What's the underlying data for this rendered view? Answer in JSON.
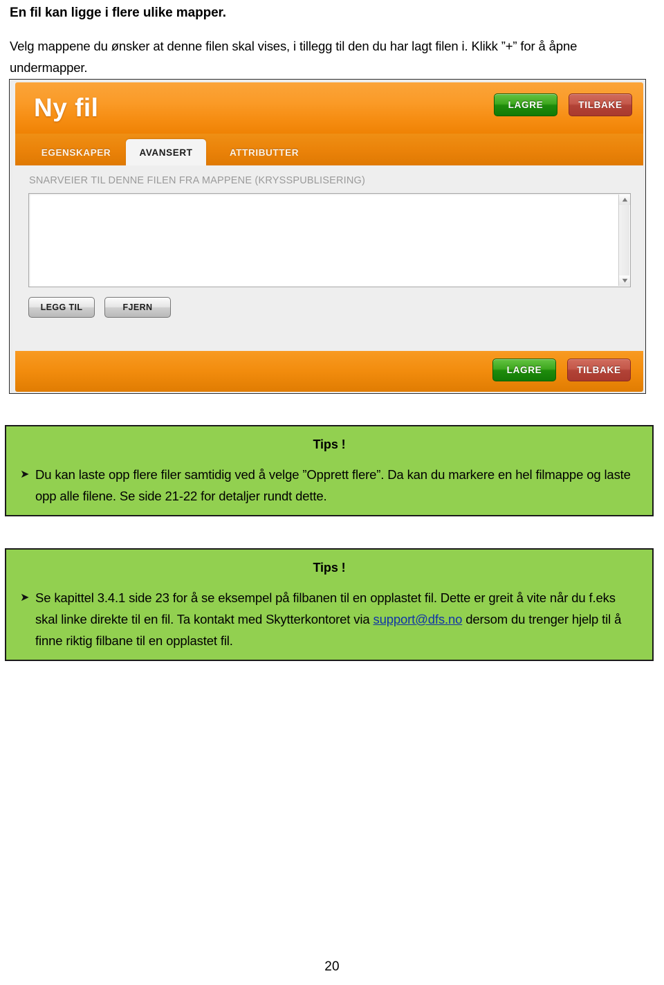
{
  "document": {
    "heading": "En fil kan ligge i flere ulike mapper.",
    "paragraph": "Velg mappene du ønsker at denne filen skal vises, i tillegg til den du har lagt filen i. Klikk ”+” for å åpne undermapper.",
    "page_number": "20"
  },
  "screenshot": {
    "app_title": "Ny fil",
    "header_buttons": {
      "save_label": "LAGRE",
      "back_label": "TILBAKE"
    },
    "tabs": [
      {
        "label": "EGENSKAPER",
        "active": false
      },
      {
        "label": "AVANSERT",
        "active": true
      },
      {
        "label": "ATTRIBUTTER",
        "active": false
      }
    ],
    "field": {
      "label": "SNARVEIER TIL DENNE FILEN FRA MAPPENE (KRYSSPUBLISERING)",
      "value": "",
      "scrollbar": {
        "up_icon": "triangle-up-icon",
        "down_icon": "triangle-down-icon"
      }
    },
    "list_buttons": {
      "add_label": "LEGG TIL",
      "remove_label": "FJERN"
    },
    "footer_buttons": {
      "save_label": "LAGRE",
      "back_label": "TILBAKE"
    },
    "colors": {
      "orange_header": "#f68d12",
      "orange_footer": "#f28c0d",
      "save_green": "#3ea81f",
      "back_red": "#c4584a",
      "body_gray": "#eeeeee",
      "active_tab": "#f4f4f4"
    }
  },
  "tips": [
    {
      "title": "Tips !",
      "bullet_glyph": "➤",
      "text_parts": [
        {
          "type": "text",
          "value": "Du kan laste opp flere filer samtidig ved å velge ”Opprett flere”. Da kan du markere en hel filmappe og laste opp alle filene. Se side 21-22 for detaljer rundt dette."
        }
      ]
    },
    {
      "title": "Tips !",
      "bullet_glyph": "➤",
      "text_parts": [
        {
          "type": "text",
          "value": "Se kapittel 3.4.1 side 23 for å se eksempel på filbanen til en opplastet fil. Dette er greit å vite når du f.eks skal linke direkte til en fil.  Ta kontakt med Skytterkontoret via "
        },
        {
          "type": "link",
          "value": "support@dfs.no"
        },
        {
          "type": "text",
          "value": " dersom du trenger hjelp til å finne riktig filbane til en opplastet fil."
        }
      ]
    }
  ],
  "theme": {
    "callout_green": "#92d050",
    "link_blue": "#1034a6"
  }
}
